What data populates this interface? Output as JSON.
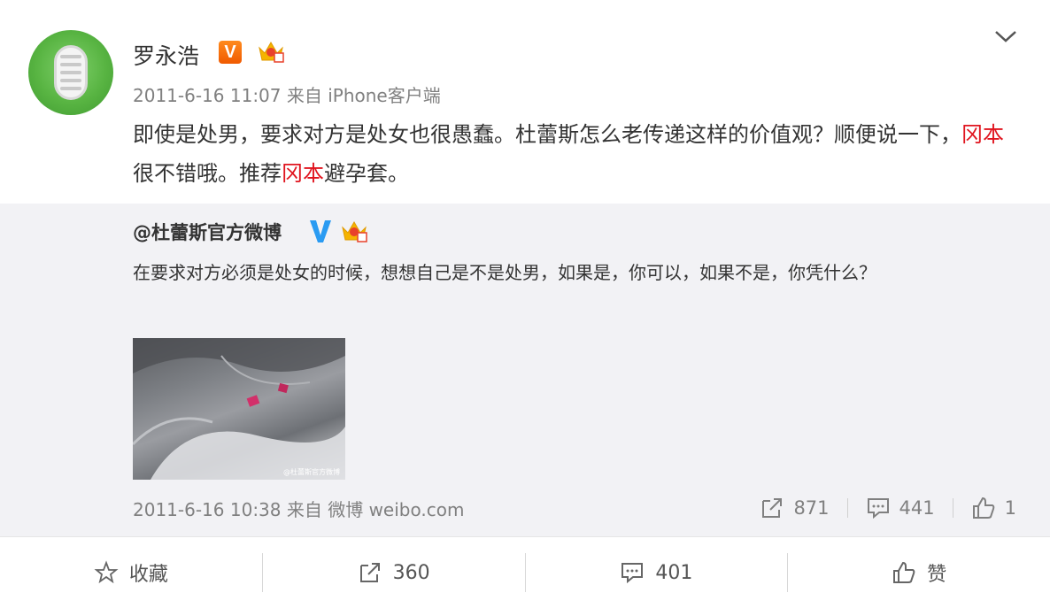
{
  "post": {
    "author": "罗永浩",
    "time_source": "2011-6-16 11:07 来自 iPhone客户端",
    "content": {
      "part1": "即使是处男，要求对方是处女也很愚蠢。杜蕾斯怎么老传递这样的价值观？顺便说一下，",
      "brand1": "冈本",
      "part2": "很不错哦。推荐",
      "brand2": "冈本",
      "part3": "避孕套。"
    }
  },
  "repost": {
    "user": "@杜蕾斯官方微博",
    "text": "在要求对方必须是处女的时候，想想自己是不是处男，如果是，你可以，如果不是，你凭什么？",
    "image_watermark": "@杜蕾斯官方微博",
    "time_source": "2011-6-16 10:38 来自 微博 weibo.com",
    "stats": {
      "forward": "871",
      "comment": "441",
      "like": "1"
    }
  },
  "actions": {
    "favorite": "收藏",
    "forward": "360",
    "comment": "401",
    "like": "赞"
  },
  "colors": {
    "highlight": "#e0141e",
    "repost_bg": "#f2f2f5",
    "verified_orange": "#f27400",
    "verified_blue": "#2a9bf2"
  }
}
